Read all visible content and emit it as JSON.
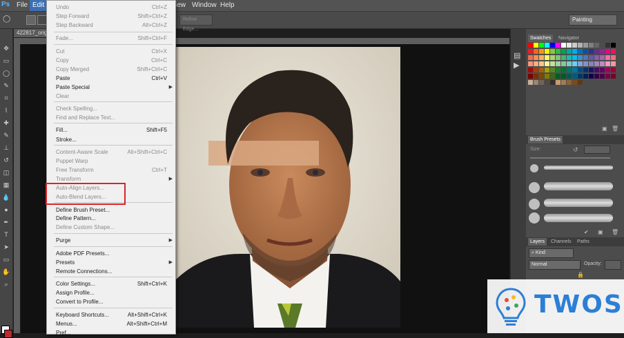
{
  "menubar": {
    "items": [
      {
        "label": "File"
      },
      {
        "label": "Edit"
      },
      {
        "label": "iew"
      },
      {
        "label": "Window"
      },
      {
        "label": "Help"
      }
    ]
  },
  "options_bar": {
    "refine_label": "Refine Edge...",
    "workspace_value": "Painting"
  },
  "document": {
    "tab_title": "422817_origi"
  },
  "edit_menu": {
    "items": [
      {
        "label": "Undo",
        "shortcut": "Ctrl+Z",
        "enabled": false
      },
      {
        "label": "Step Forward",
        "shortcut": "Shift+Ctrl+Z",
        "enabled": false
      },
      {
        "label": "Step Backward",
        "shortcut": "Alt+Ctrl+Z",
        "enabled": false
      },
      {
        "label": "Fade...",
        "shortcut": "Shift+Ctrl+F",
        "enabled": false
      },
      {
        "label": "Cut",
        "shortcut": "Ctrl+X",
        "enabled": false
      },
      {
        "label": "Copy",
        "shortcut": "Ctrl+C",
        "enabled": false
      },
      {
        "label": "Copy Merged",
        "shortcut": "Shift+Ctrl+C",
        "enabled": false
      },
      {
        "label": "Paste",
        "shortcut": "Ctrl+V",
        "enabled": true
      },
      {
        "label": "Paste Special",
        "shortcut": "",
        "enabled": true,
        "submenu": true
      },
      {
        "label": "Clear",
        "shortcut": "",
        "enabled": false
      },
      {
        "label": "Check Spelling...",
        "shortcut": "",
        "enabled": false
      },
      {
        "label": "Find and Replace Text...",
        "shortcut": "",
        "enabled": false
      },
      {
        "label": "Fill...",
        "shortcut": "Shift+F5",
        "enabled": true
      },
      {
        "label": "Stroke...",
        "shortcut": "",
        "enabled": true
      },
      {
        "label": "Content-Aware Scale",
        "shortcut": "Alt+Shift+Ctrl+C",
        "enabled": false
      },
      {
        "label": "Puppet Warp",
        "shortcut": "",
        "enabled": false
      },
      {
        "label": "Free Transform",
        "shortcut": "Ctrl+T",
        "enabled": false
      },
      {
        "label": "Transform",
        "shortcut": "",
        "enabled": false,
        "submenu": true
      },
      {
        "label": "Auto-Align Layers...",
        "shortcut": "",
        "enabled": false
      },
      {
        "label": "Auto-Blend Layers...",
        "shortcut": "",
        "enabled": false
      },
      {
        "label": "Define Brush Preset...",
        "shortcut": "",
        "enabled": true
      },
      {
        "label": "Define Pattern...",
        "shortcut": "",
        "enabled": true
      },
      {
        "label": "Define Custom Shape...",
        "shortcut": "",
        "enabled": false
      },
      {
        "label": "Purge",
        "shortcut": "",
        "enabled": true,
        "submenu": true
      },
      {
        "label": "Adobe PDF Presets...",
        "shortcut": "",
        "enabled": true
      },
      {
        "label": "Presets",
        "shortcut": "",
        "enabled": true,
        "submenu": true
      },
      {
        "label": "Remote Connections...",
        "shortcut": "",
        "enabled": true
      },
      {
        "label": "Color Settings...",
        "shortcut": "Shift+Ctrl+K",
        "enabled": true
      },
      {
        "label": "Assign Profile...",
        "shortcut": "",
        "enabled": true
      },
      {
        "label": "Convert to Profile...",
        "shortcut": "",
        "enabled": true
      },
      {
        "label": "Keyboard Shortcuts...",
        "shortcut": "Alt+Shift+Ctrl+K",
        "enabled": true
      },
      {
        "label": "Menus...",
        "shortcut": "Alt+Shift+Ctrl+M",
        "enabled": true
      },
      {
        "label": "Pref...",
        "shortcut": "",
        "enabled": true
      }
    ]
  },
  "panels": {
    "swatches_tab": "Swatches",
    "navigator_tab": "Navigator",
    "brush_presets_tab": "Brush Presets",
    "size_label": "Size:",
    "layers_tab": "Layers",
    "channels_tab": "Channels",
    "paths_tab": "Paths",
    "kind_value": "Kind",
    "blend_mode": "Normal",
    "opacity_label": "Opacity:"
  },
  "watermark": {
    "text": "TWOS"
  }
}
